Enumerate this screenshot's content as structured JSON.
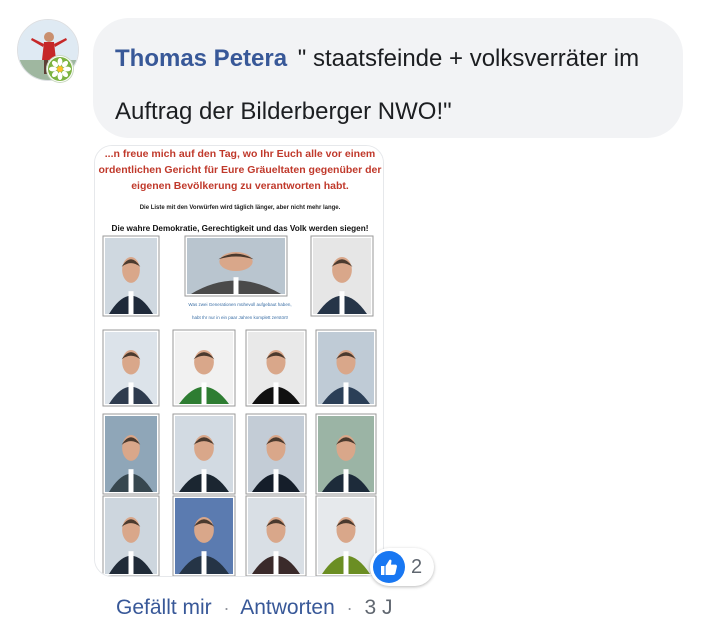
{
  "comment": {
    "author": "Thomas Petera",
    "text": "\" staatsfeinde + volksverräter im Auftrag der Bilderberger NWO!\""
  },
  "attachment": {
    "header_lines": [
      "...n freue mich auf den Tag, wo Ihr Euch alle vor einem",
      "ordentlichen Gericht für Eure Gräueltaten gegenüber der",
      "eigenen Bevölkerung zu verantworten habt."
    ],
    "subline": "Die Liste mit den Vorwürfen wird täglich länger, aber nicht mehr lange.",
    "slogan": "Die wahre Demokratie, Gerechtigkeit und das Volk werden siegen!",
    "caption_lines": [
      "Was zwei Generationen mühevoll aufgebaut haben,",
      "habt Ihr nur in ein paar Jahren komplett zerstört!"
    ]
  },
  "reactions": {
    "icon": "thumbs-up-icon",
    "count": "2"
  },
  "actions": {
    "like": "Gefällt mir",
    "reply": "Antworten",
    "time": "3 J",
    "separator": "·"
  },
  "colors": {
    "author": "#385898",
    "bubble": "#f2f3f5",
    "header_text": "#c0392b",
    "like_blue": "#1877f2"
  }
}
